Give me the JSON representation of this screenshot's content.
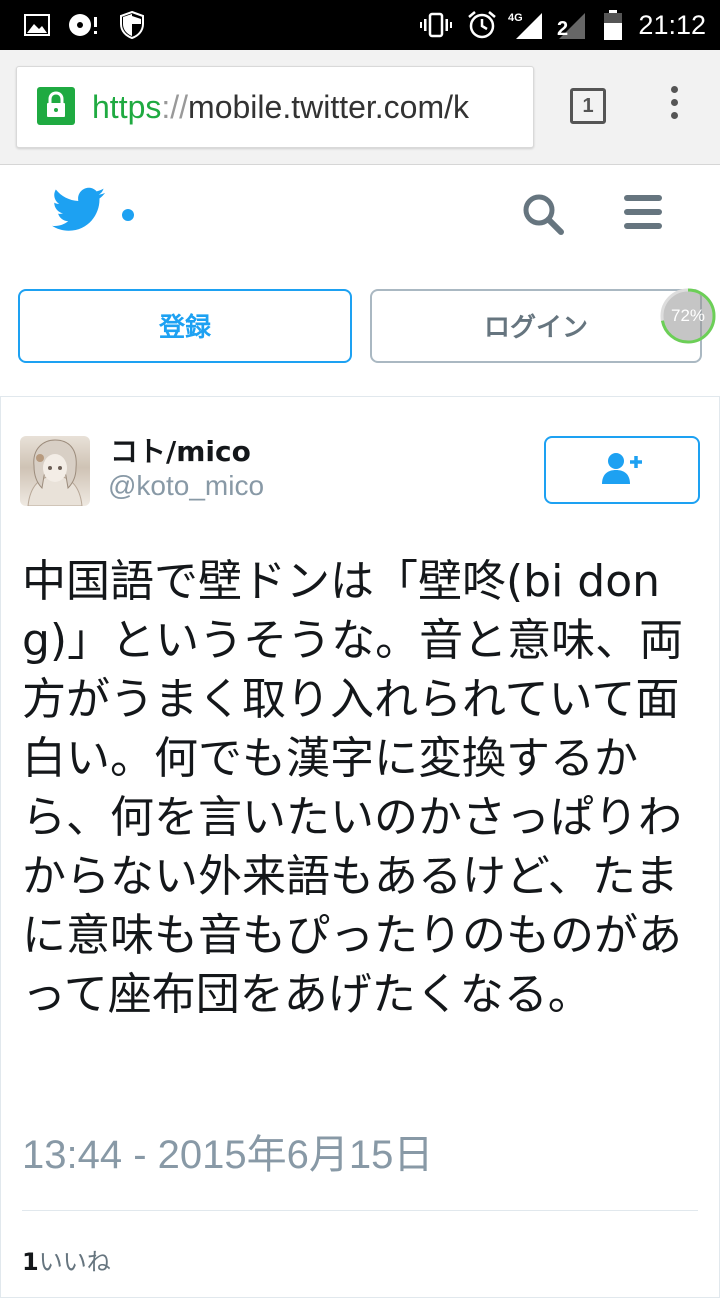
{
  "status_bar": {
    "time": "21:12",
    "network_label": "4G",
    "sim_label": "2",
    "icons": [
      "image-icon",
      "media-icon",
      "shield-icon",
      "vibrate-icon",
      "alarm-icon",
      "signal-icon",
      "battery-icon"
    ]
  },
  "browser": {
    "url_scheme": "https",
    "url_sep": "://",
    "url_rest": "mobile.twitter.com/k",
    "tab_count": "1"
  },
  "header": {
    "brand_color": "#1da1f2",
    "icons": [
      "twitter-bird-icon",
      "search-icon",
      "menu-icon"
    ]
  },
  "auth": {
    "signup_label": "登録",
    "login_label": "ログイン",
    "progress_label": "72%",
    "progress_value": 0.72
  },
  "tweet": {
    "display_name": "コト/mico",
    "handle": "@koto_mico",
    "text": "中国語で壁ドンは「壁咚(bi dong)」というそうな。音と意味、両方がうまく取り入れられていて面白い。何でも漢字に変換するから、何を言いたいのかさっぱりわからない外来語もあるけど、たまに意味も音もぴったりのものがあって座布団をあげたくなる。",
    "timestamp": "13:44 - 2015年6月15日",
    "like_count": "1",
    "like_label": "いいね"
  }
}
